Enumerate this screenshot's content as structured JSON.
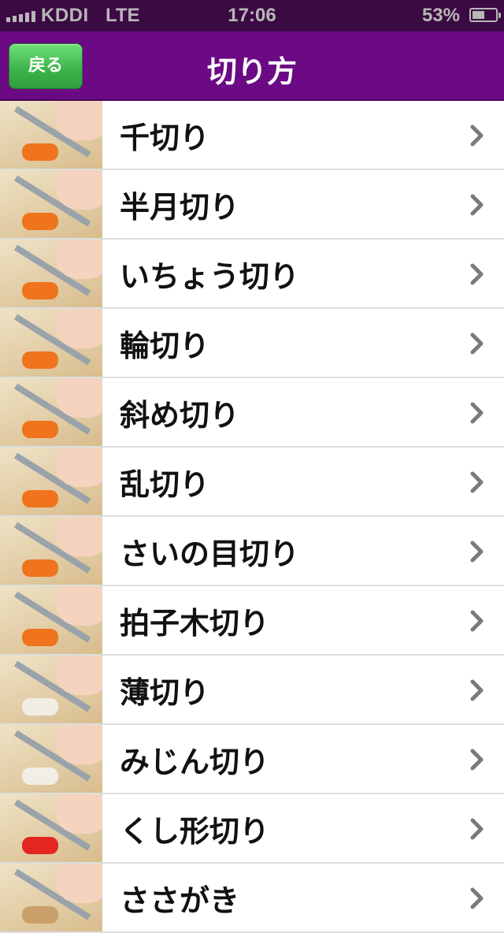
{
  "status_bar": {
    "carrier": "KDDI",
    "network": "LTE",
    "time": "17:06",
    "battery_percent_text": "53%",
    "battery_level": 0.53
  },
  "nav": {
    "back_label": "戻る",
    "title": "切り方"
  },
  "list": {
    "items": [
      {
        "label": "千切り",
        "food_color": "#f0731e"
      },
      {
        "label": "半月切り",
        "food_color": "#f0731e"
      },
      {
        "label": "いちょう切り",
        "food_color": "#f0731e"
      },
      {
        "label": "輪切り",
        "food_color": "#f0731e"
      },
      {
        "label": "斜め切り",
        "food_color": "#f0731e"
      },
      {
        "label": "乱切り",
        "food_color": "#f0731e"
      },
      {
        "label": "さいの目切り",
        "food_color": "#f0731e"
      },
      {
        "label": "拍子木切り",
        "food_color": "#f0731e"
      },
      {
        "label": "薄切り",
        "food_color": "#f1eee6"
      },
      {
        "label": "みじん切り",
        "food_color": "#f1eee6"
      },
      {
        "label": "くし形切り",
        "food_color": "#e3261f"
      },
      {
        "label": "ささがき",
        "food_color": "#c9a06a"
      }
    ]
  },
  "colors": {
    "status_bar_bg": "#3c0a43",
    "nav_bar_bg": "#6c0984",
    "back_button_green": "#3fb54c",
    "chevron": "#7a7a7a"
  },
  "icons": {
    "chevron": "chevron-right-icon",
    "signal": "signal-bars-icon",
    "battery": "battery-icon"
  }
}
